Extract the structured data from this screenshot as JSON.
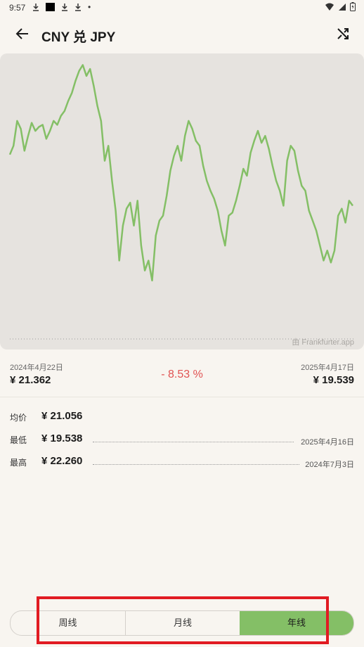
{
  "status_bar": {
    "time": "9:57",
    "dot": "•"
  },
  "header": {
    "title": "CNY 兑 JPY",
    "back_icon": "arrow-left-icon",
    "shuffle_icon": "shuffle-icon"
  },
  "chart_source": "由 Frankfurter.app",
  "range": {
    "start_date": "2024年4月22日",
    "start_value": "¥ 21.362",
    "end_date": "2025年4月17日",
    "end_value": "¥ 19.539",
    "change": "- 8.53 %"
  },
  "stats": {
    "avg_label": "均价",
    "avg_value": "¥ 21.056",
    "low_label": "最低",
    "low_value": "¥ 19.538",
    "low_date": "2025年4月16日",
    "high_label": "最高",
    "high_value": "¥ 22.260",
    "high_date": "2024年7月3日"
  },
  "tabs": {
    "week": "周线",
    "month": "月线",
    "year": "年线",
    "selected": "year"
  },
  "colors": {
    "line": "#84bf66",
    "accent": "#84bf66",
    "negative": "#e05252",
    "highlight": "#e11b22"
  },
  "chart_data": {
    "type": "line",
    "series": [
      {
        "values": [
          21.362,
          21.45,
          21.7,
          21.62,
          21.4,
          21.55,
          21.68,
          21.6,
          21.64,
          21.66,
          21.52,
          21.6,
          21.7,
          21.66,
          21.75,
          21.8,
          21.9,
          21.98,
          22.1,
          22.2,
          22.26,
          22.15,
          22.22,
          22.05,
          21.85,
          21.7,
          21.3,
          21.45,
          21.1,
          20.8,
          20.3,
          20.65,
          20.82,
          20.88,
          20.65,
          20.9,
          20.45,
          20.2,
          20.3,
          20.1,
          20.55,
          20.7,
          20.75,
          20.95,
          21.2,
          21.35,
          21.45,
          21.3,
          21.55,
          21.7,
          21.62,
          21.5,
          21.45,
          21.25,
          21.1,
          21.0,
          20.92,
          20.8,
          20.6,
          20.45,
          20.75,
          20.78,
          20.9,
          21.05,
          21.22,
          21.15,
          21.38,
          21.5,
          21.6,
          21.48,
          21.55,
          21.42,
          21.25,
          21.1,
          21.0,
          20.85,
          21.3,
          21.45,
          21.4,
          21.2,
          21.05,
          21.0,
          20.8,
          20.7,
          20.6,
          20.45,
          20.3,
          20.4,
          20.28,
          20.4,
          20.75,
          20.82,
          20.68,
          20.9,
          20.85
        ]
      }
    ]
  }
}
